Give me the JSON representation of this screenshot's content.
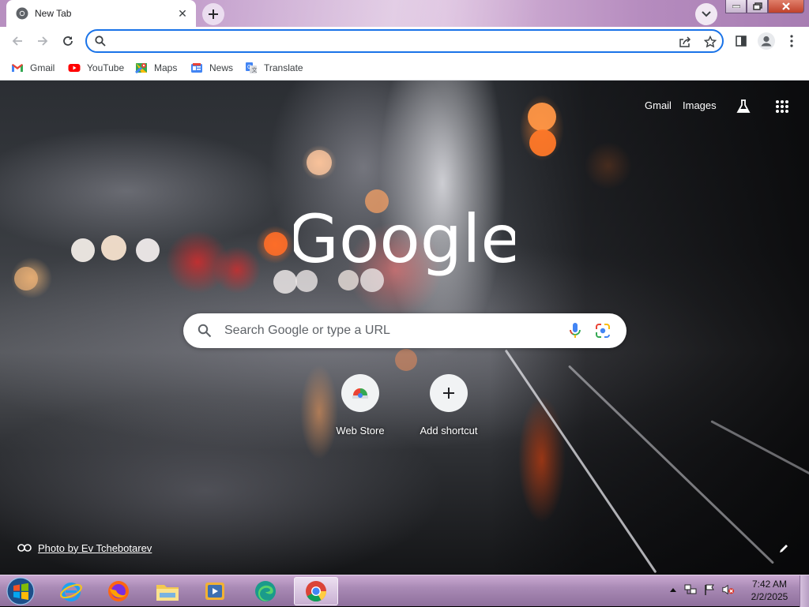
{
  "window": {
    "tab": {
      "title": "New Tab",
      "icon": "chrome-icon"
    },
    "buttons": [
      "minimize-icon",
      "maximize-icon",
      "close-icon"
    ]
  },
  "toolbar": {
    "address_value": "",
    "address_placeholder": "",
    "icons": [
      "back-icon",
      "forward-icon",
      "reload-icon",
      "share-icon",
      "star-icon",
      "side-panel-icon",
      "profile-icon",
      "menu-icon"
    ]
  },
  "bookmarks": [
    {
      "label": "Gmail",
      "icon": "gmail-icon"
    },
    {
      "label": "YouTube",
      "icon": "youtube-icon"
    },
    {
      "label": "Maps",
      "icon": "maps-icon"
    },
    {
      "label": "News",
      "icon": "news-icon"
    },
    {
      "label": "Translate",
      "icon": "translate-icon"
    }
  ],
  "ntp": {
    "top_links": {
      "gmail": "Gmail",
      "images": "Images"
    },
    "logo_text": "Google",
    "search_placeholder": "Search Google or type a URL",
    "shortcuts": [
      {
        "label": "Web Store",
        "icon": "web-store-icon"
      },
      {
        "label": "Add shortcut",
        "icon": "plus-icon"
      }
    ],
    "photo_credit": "Photo by Ev Tchebotarev"
  },
  "taskbar": {
    "apps": [
      "internet-explorer-icon",
      "firefox-icon",
      "file-explorer-icon",
      "media-player-icon",
      "edge-icon",
      "chrome-icon"
    ],
    "clock": {
      "time": "7:42 AM",
      "date": "2/2/2025"
    }
  },
  "colors": {
    "accent": "#1a73e8",
    "tab_bg": "#ffffff",
    "taskbar": "#a98ab5"
  }
}
